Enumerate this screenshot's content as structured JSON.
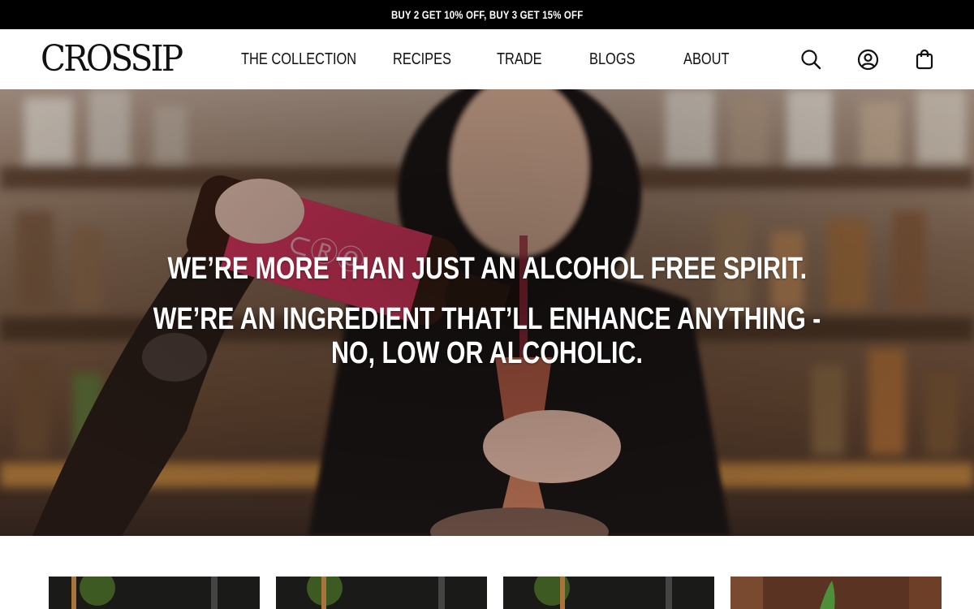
{
  "announcement": {
    "text": "BUY 2 GET 10% OFF, BUY 3 GET 15% OFF"
  },
  "logo": {
    "text": "CROSSIP"
  },
  "nav": {
    "items": [
      {
        "label": "THE COLLECTION"
      },
      {
        "label": "RECIPES"
      },
      {
        "label": "TRADE"
      },
      {
        "label": "BLOGS"
      },
      {
        "label": "ABOUT"
      }
    ]
  },
  "header_icons": [
    "search-icon",
    "account-icon",
    "cart-icon"
  ],
  "hero": {
    "line1": "WE’RE MORE THAN JUST AN ALCOHOL FREE SPIRIT.",
    "line2": "WE’RE AN INGREDIENT THAT’LL ENHANCE ANYTHING -",
    "line3": "NO, LOW OR ALCOHOLIC."
  },
  "colors": {
    "announcement_bg": "#000000",
    "header_bg": "#ffffff",
    "text": "#111111",
    "bottle_label": "#d9375f"
  }
}
